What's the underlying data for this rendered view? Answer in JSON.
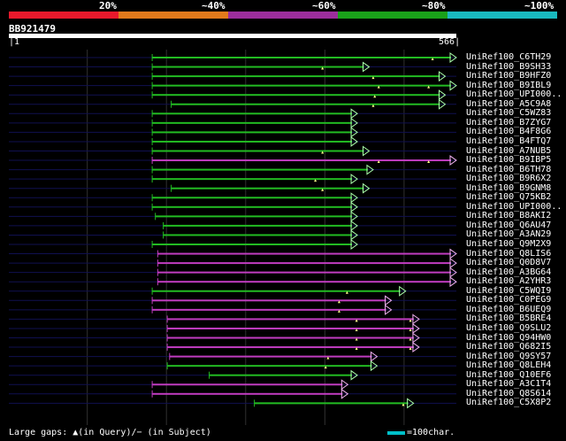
{
  "header": {
    "percent_labels": [
      "20%",
      "~40%",
      "~60%",
      "~80%",
      "~100%"
    ],
    "legend_colors": [
      "#e8192c",
      "#e27a1c",
      "#9c2e9c",
      "#1aa11a",
      "#19b9bf"
    ]
  },
  "query": {
    "id": "BB921479",
    "length": 566,
    "start_label": "1",
    "end_label": "566"
  },
  "colors": {
    "green": "#22bb22",
    "magenta": "#c03cc0",
    "arrow_green": "#aaffaa",
    "arrow_magenta": "#f0b0f0",
    "background_line": "#101050",
    "grid": "#303030",
    "gap_marker": "#ffff88"
  },
  "hits": [
    {
      "label": "UniRef100_C6TH29",
      "start": 182,
      "end": 566,
      "color": "green",
      "gaps": [
        536
      ]
    },
    {
      "label": "UniRef100_B9SH33",
      "start": 182,
      "end": 456,
      "color": "green",
      "gaps": [
        397
      ]
    },
    {
      "label": "UniRef100_B9HFZ0",
      "start": 182,
      "end": 552,
      "color": "green",
      "gaps": [
        461
      ]
    },
    {
      "label": "UniRef100_B9IBL9",
      "start": 182,
      "end": 566,
      "color": "green",
      "gaps": [
        468,
        531
      ]
    },
    {
      "label": "UniRef100_UPI000..",
      "start": 182,
      "end": 552,
      "color": "green",
      "gaps": [
        463
      ]
    },
    {
      "label": "UniRef100_A5C9A8",
      "start": 206,
      "end": 552,
      "color": "green",
      "gaps": [
        461
      ]
    },
    {
      "label": "UniRef100_C5WZ83",
      "start": 182,
      "end": 441,
      "color": "green",
      "gaps": []
    },
    {
      "label": "UniRef100_B7ZYG7",
      "start": 182,
      "end": 441,
      "color": "green",
      "gaps": []
    },
    {
      "label": "UniRef100_B4F8G6",
      "start": 182,
      "end": 441,
      "color": "green",
      "gaps": []
    },
    {
      "label": "UniRef100_B4FTQ7",
      "start": 182,
      "end": 441,
      "color": "green",
      "gaps": []
    },
    {
      "label": "UniRef100_A7NUB5",
      "start": 182,
      "end": 456,
      "color": "green",
      "gaps": [
        397
      ]
    },
    {
      "label": "UniRef100_B9IBP5",
      "start": 182,
      "end": 566,
      "color": "magenta",
      "gaps": [
        468,
        531
      ]
    },
    {
      "label": "UniRef100_B6TH78",
      "start": 182,
      "end": 461,
      "color": "green",
      "gaps": []
    },
    {
      "label": "UniRef100_B9R6X2",
      "start": 182,
      "end": 441,
      "color": "green",
      "gaps": [
        388
      ]
    },
    {
      "label": "UniRef100_B9GNM8",
      "start": 206,
      "end": 456,
      "color": "green",
      "gaps": [
        397
      ]
    },
    {
      "label": "UniRef100_Q75KB2",
      "start": 182,
      "end": 441,
      "color": "green",
      "gaps": []
    },
    {
      "label": "UniRef100_UPI000..",
      "start": 182,
      "end": 441,
      "color": "green",
      "gaps": []
    },
    {
      "label": "UniRef100_B8AKI2",
      "start": 186,
      "end": 441,
      "color": "green",
      "gaps": []
    },
    {
      "label": "UniRef100_Q6AU47",
      "start": 196,
      "end": 441,
      "color": "green",
      "gaps": []
    },
    {
      "label": "UniRef100_A3AN29",
      "start": 196,
      "end": 441,
      "color": "green",
      "gaps": []
    },
    {
      "label": "UniRef100_Q9M2X9",
      "start": 182,
      "end": 441,
      "color": "green",
      "gaps": []
    },
    {
      "label": "UniRef100_Q8LIS6",
      "start": 189,
      "end": 566,
      "color": "magenta",
      "gaps": []
    },
    {
      "label": "UniRef100_Q0D8V7",
      "start": 189,
      "end": 566,
      "color": "magenta",
      "gaps": []
    },
    {
      "label": "UniRef100_A3BG64",
      "start": 189,
      "end": 566,
      "color": "magenta",
      "gaps": []
    },
    {
      "label": "UniRef100_A2YHR3",
      "start": 189,
      "end": 566,
      "color": "magenta",
      "gaps": []
    },
    {
      "label": "UniRef100_C5WQI9",
      "start": 182,
      "end": 502,
      "color": "green",
      "gaps": [
        428
      ]
    },
    {
      "label": "UniRef100_C0PEG9",
      "start": 182,
      "end": 484,
      "color": "magenta",
      "gaps": [
        418
      ]
    },
    {
      "label": "UniRef100_B6UEQ9",
      "start": 182,
      "end": 484,
      "color": "magenta",
      "gaps": [
        418
      ]
    },
    {
      "label": "UniRef100_B5BRE4",
      "start": 201,
      "end": 519,
      "color": "magenta",
      "gaps": [
        440,
        508
      ]
    },
    {
      "label": "UniRef100_Q9SLU2",
      "start": 201,
      "end": 519,
      "color": "magenta",
      "gaps": [
        440,
        508
      ]
    },
    {
      "label": "UniRef100_Q94HW0",
      "start": 201,
      "end": 519,
      "color": "magenta",
      "gaps": [
        440,
        508
      ]
    },
    {
      "label": "UniRef100_Q682I5",
      "start": 201,
      "end": 519,
      "color": "magenta",
      "gaps": [
        440,
        508
      ]
    },
    {
      "label": "UniRef100_Q9SY57",
      "start": 204,
      "end": 466,
      "color": "magenta",
      "gaps": [
        404
      ]
    },
    {
      "label": "UniRef100_Q8LEH4",
      "start": 201,
      "end": 466,
      "color": "green",
      "gaps": [
        401
      ]
    },
    {
      "label": "UniRef100_Q10EF6",
      "start": 254,
      "end": 441,
      "color": "green",
      "gaps": []
    },
    {
      "label": "UniRef100_A3C1T4",
      "start": 182,
      "end": 429,
      "color": "magenta",
      "gaps": []
    },
    {
      "label": "UniRef100_Q8S614",
      "start": 182,
      "end": 429,
      "color": "magenta",
      "gaps": []
    },
    {
      "label": "UniRef100_C5X8P2",
      "start": 311,
      "end": 512,
      "color": "green",
      "gaps": [
        499
      ]
    }
  ],
  "footer": {
    "gaps_text": "Large gaps: ▲(in Query)/− (in Subject)",
    "scale_text": "=100char."
  }
}
